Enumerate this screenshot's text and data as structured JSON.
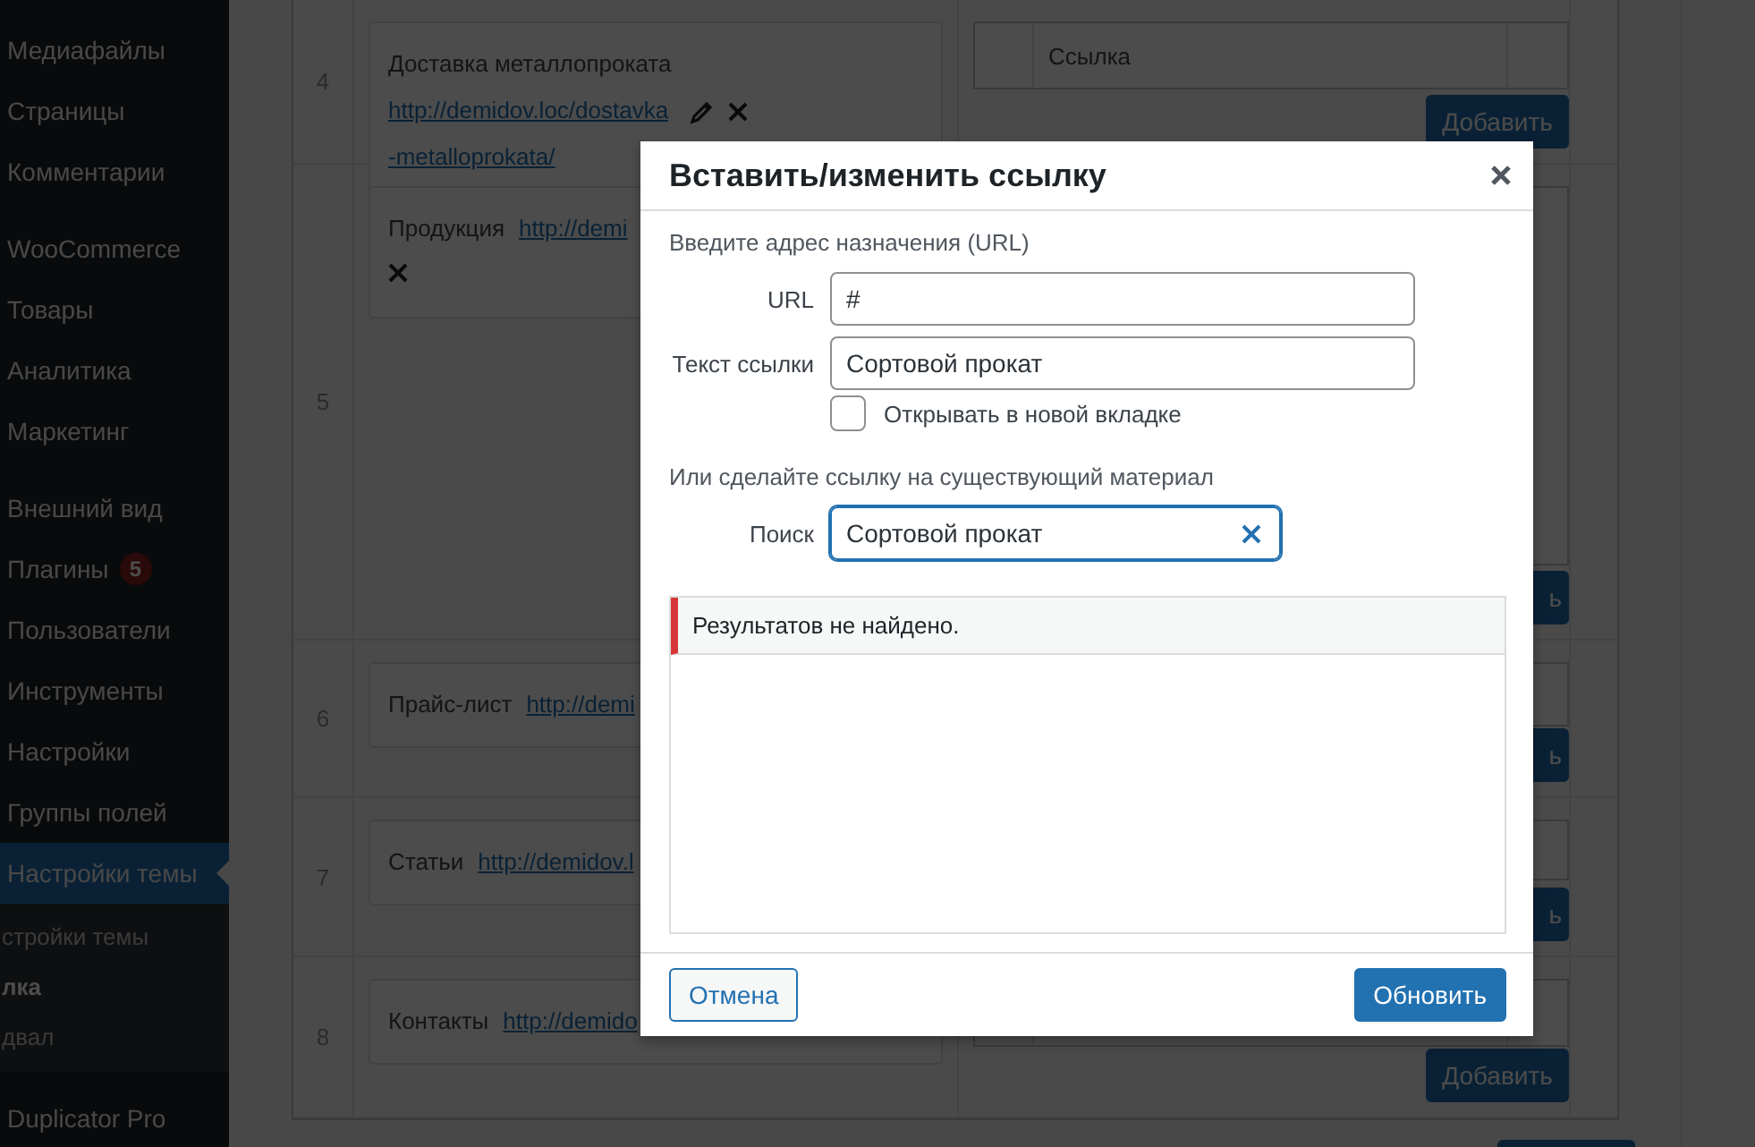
{
  "sidebar": {
    "sections": [
      [
        {
          "label": "Медиафайлы",
          "selected": false
        },
        {
          "label": "Страницы",
          "selected": false
        },
        {
          "label": "Комментарии",
          "selected": false
        }
      ],
      [
        {
          "label": "WooCommerce",
          "selected": false
        },
        {
          "label": "Товары",
          "selected": false
        },
        {
          "label": "Аналитика",
          "selected": false
        },
        {
          "label": "Маркетинг",
          "selected": false
        }
      ],
      [
        {
          "label": "Внешний вид",
          "selected": false
        },
        {
          "label": "Плагины",
          "selected": false,
          "badge": "5"
        },
        {
          "label": "Пользователи",
          "selected": false
        },
        {
          "label": "Инструменты",
          "selected": false
        },
        {
          "label": "Настройки",
          "selected": false
        },
        {
          "label": "Группы полей",
          "selected": false
        },
        {
          "label": "Настройки темы",
          "selected": true,
          "submenu": [
            {
              "label": "стройки темы",
              "selected": false
            },
            {
              "label": "лка",
              "selected": true
            },
            {
              "label": "двал",
              "selected": false
            }
          ]
        }
      ],
      [
        {
          "label": "Duplicator Pro",
          "selected": false
        }
      ]
    ]
  },
  "table": {
    "rows": [
      {
        "number": "4",
        "title": "Доставка металлопроката",
        "link": "http://demidov.loc/dostavka-metalloprokata/",
        "editable": true,
        "removable": true,
        "column_3": "Ссылка",
        "button": "Добавить"
      },
      {
        "number": "5",
        "title": "Продукция",
        "link": "http://demi",
        "editable": false,
        "removable": true,
        "button": "ь"
      },
      {
        "number": "6",
        "title": "Прайс-лист",
        "link": "http://demi",
        "editable": false,
        "removable": false,
        "button": "ь"
      },
      {
        "number": "7",
        "title": "Статьи",
        "link": "http://demidov.l",
        "editable": false,
        "removable": false,
        "button": "ь"
      },
      {
        "number": "8",
        "title": "Контакты",
        "link": "http://demido",
        "editable": false,
        "removable": false,
        "button": "Добавить"
      }
    ]
  },
  "dialog": {
    "title": "Вставить/изменить ссылку",
    "url_section": "Введите адрес назначения (URL)",
    "fields": [
      {
        "label": "URL",
        "value": "#"
      },
      {
        "label": "Текст ссылки",
        "value": "Сортовой прокат"
      }
    ],
    "new_tab": {
      "label": "Открывать в новой вкладке",
      "checked": false
    },
    "existing_section": "Или сделайте ссылку на существующий материал",
    "search": {
      "label": "Поиск",
      "value": "Сортовой прокат"
    },
    "results_notice": "Результатов не найдено.",
    "buttons": {
      "cancel": "Отмена",
      "submit": "Обновить"
    }
  }
}
